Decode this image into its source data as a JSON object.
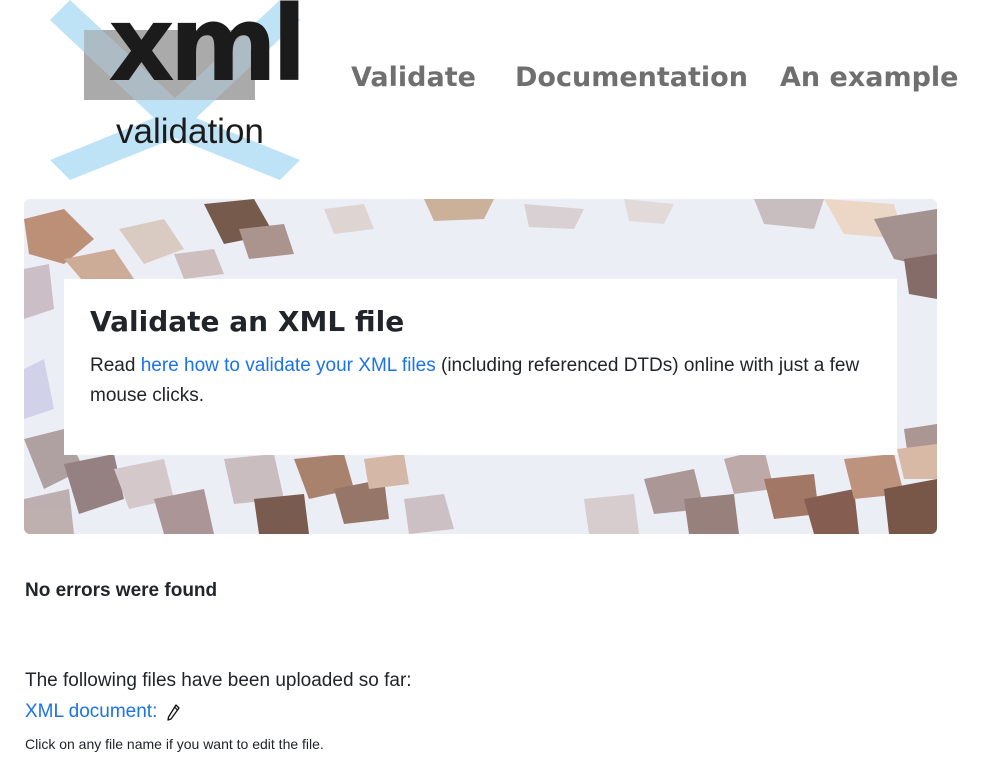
{
  "logo": {
    "word": "xml",
    "subword": "validation"
  },
  "nav": {
    "items": [
      {
        "label": "Validate"
      },
      {
        "label": "Documentation"
      },
      {
        "label": "An example"
      }
    ]
  },
  "hero": {
    "title": "Validate an XML file",
    "text_before": "Read ",
    "link": "here how to validate your XML files",
    "text_after": " (including referenced DTDs) online with just a few mouse clicks."
  },
  "status": "No errors were found",
  "files": {
    "intro": "The following files have been uploaded so far:",
    "items": [
      {
        "label": "XML document:",
        "icon": "pencil-icon"
      }
    ],
    "hint": "Click on any file name if you want to edit the file."
  },
  "colors": {
    "link": "#1a73e8",
    "nav": "#6f6f6f",
    "logo_cross": "#bfe3f6",
    "logo_box": "#9b9b9b"
  }
}
